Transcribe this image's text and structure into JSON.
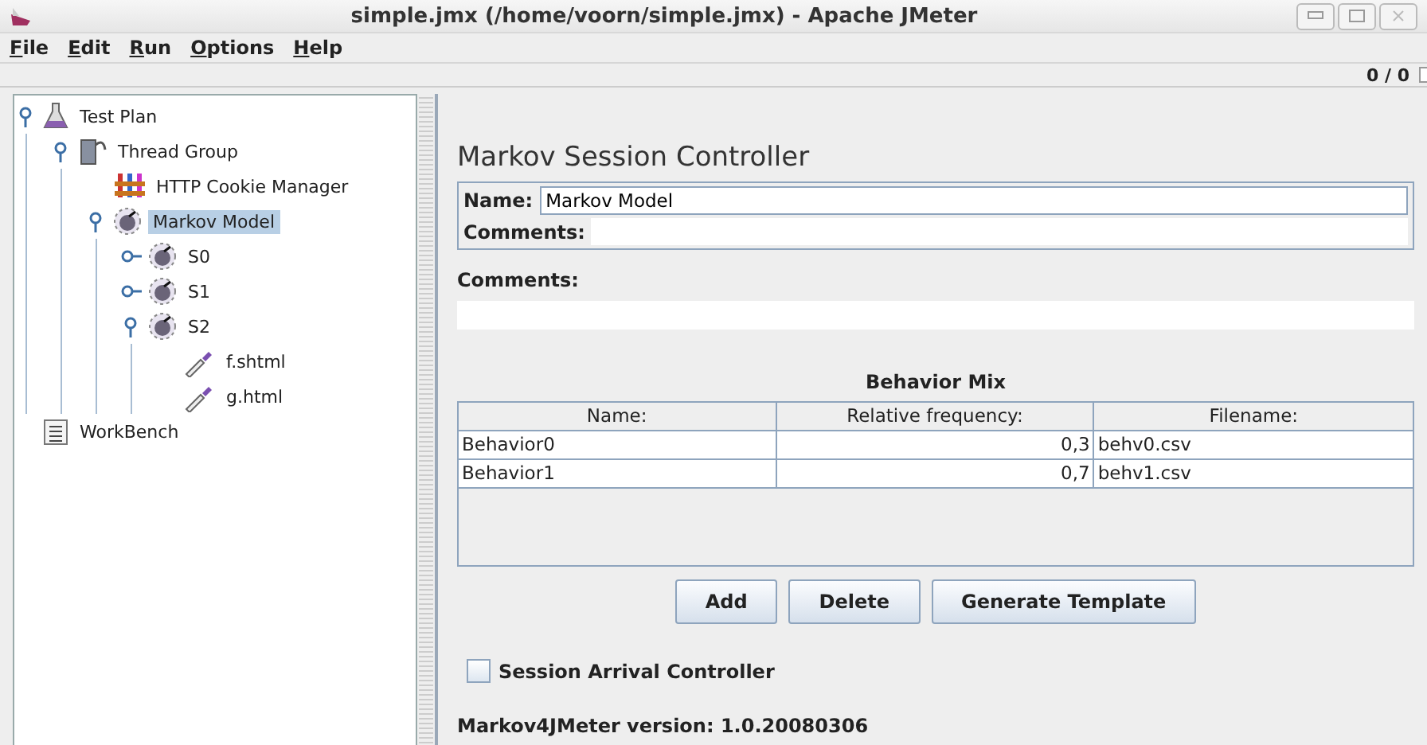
{
  "window": {
    "title": "simple.jmx (/home/voorn/simple.jmx) - Apache JMeter"
  },
  "menu": [
    "File",
    "Edit",
    "Run",
    "Options",
    "Help"
  ],
  "toolbar": {
    "counter": "0 / 0"
  },
  "tree": [
    {
      "label": "Test Plan",
      "kind": "plan",
      "expanded": true,
      "selected": false,
      "children": [
        {
          "label": "Thread Group",
          "kind": "thread",
          "expanded": true,
          "selected": false,
          "children": [
            {
              "label": "HTTP Cookie Manager",
              "kind": "cookie",
              "selected": false
            },
            {
              "label": "Markov Model",
              "kind": "markov",
              "expanded": true,
              "selected": true,
              "children": [
                {
                  "label": "S0",
                  "kind": "markov",
                  "expanded": false,
                  "selected": false
                },
                {
                  "label": "S1",
                  "kind": "markov",
                  "expanded": false,
                  "selected": false
                },
                {
                  "label": "S2",
                  "kind": "markov",
                  "expanded": true,
                  "selected": false,
                  "children": [
                    {
                      "label": "f.shtml",
                      "kind": "sampler",
                      "selected": false
                    },
                    {
                      "label": "g.html",
                      "kind": "sampler",
                      "selected": false
                    }
                  ]
                }
              ]
            }
          ]
        }
      ]
    },
    {
      "label": "WorkBench",
      "kind": "workbench",
      "selected": false
    }
  ],
  "editor": {
    "title": "Markov Session Controller",
    "name_label": "Name:",
    "name_value": "Markov Model",
    "comments_label": "Comments:",
    "comments2_label": "Comments:",
    "table": {
      "title": "Behavior Mix",
      "columns": [
        "Name:",
        "Relative frequency:",
        "Filename:"
      ],
      "rows": [
        [
          "Behavior0",
          "0,3",
          "behv0.csv"
        ],
        [
          "Behavior1",
          "0,7",
          "behv1.csv"
        ]
      ]
    },
    "buttons": [
      "Add",
      "Delete",
      "Generate Template"
    ],
    "checkbox": {
      "label": "Session Arrival Controller",
      "checked": false
    },
    "version": "Markov4JMeter version: 1.0.20080306"
  }
}
